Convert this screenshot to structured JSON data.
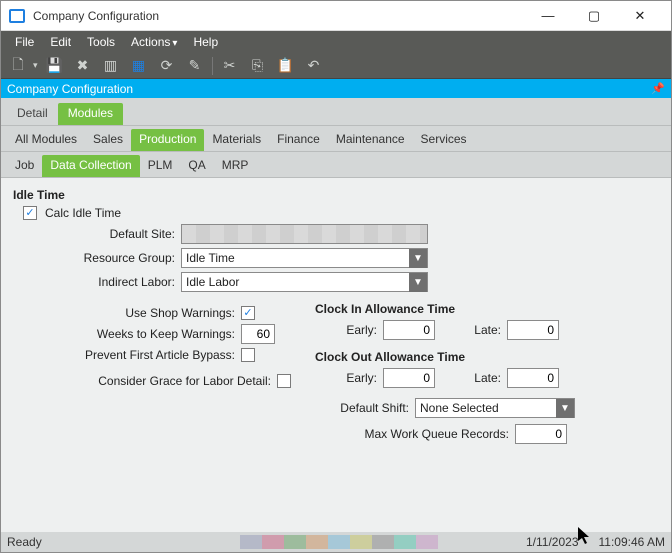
{
  "window": {
    "title": "Company Configuration"
  },
  "menus": {
    "file": "File",
    "edit": "Edit",
    "tools": "Tools",
    "actions": "Actions",
    "help": "Help"
  },
  "bluebar": {
    "label": "Company Configuration"
  },
  "tabs_group1": {
    "detail": "Detail",
    "modules": "Modules"
  },
  "tabs_group2": {
    "all_modules": "All Modules",
    "sales": "Sales",
    "production": "Production",
    "materials": "Materials",
    "finance": "Finance",
    "maintenance": "Maintenance",
    "services": "Services"
  },
  "tabs_group3": {
    "job": "Job",
    "data_collection": "Data Collection",
    "plm": "PLM",
    "qa": "QA",
    "mrp": "MRP"
  },
  "idle": {
    "section": "Idle Time",
    "calc_label": "Calc Idle Time",
    "calc_checked": true,
    "default_site_label": "Default Site:",
    "default_site_value": "",
    "resource_group_label": "Resource Group:",
    "resource_group_value": "Idle Time",
    "indirect_labor_label": "Indirect Labor:",
    "indirect_labor_value": "Idle Labor"
  },
  "options": {
    "use_shop_warnings_label": "Use Shop Warnings:",
    "use_shop_warnings_checked": true,
    "weeks_label": "Weeks to Keep Warnings:",
    "weeks_value": "60",
    "prevent_label": "Prevent First Article Bypass:",
    "prevent_checked": false,
    "grace_label": "Consider Grace for Labor Detail:",
    "grace_checked": false
  },
  "allowance": {
    "clock_in_title": "Clock In Allowance Time",
    "clock_out_title": "Clock Out Allowance Time",
    "early_label": "Early:",
    "late_label": "Late:",
    "in_early": "0",
    "in_late": "0",
    "out_early": "0",
    "out_late": "0",
    "default_shift_label": "Default Shift:",
    "default_shift_value": "None Selected",
    "max_queue_label": "Max Work Queue Records:",
    "max_queue_value": "0"
  },
  "status": {
    "ready": "Ready",
    "date": "1/11/2023",
    "time": "11:09:46 AM"
  },
  "swatch_colors": [
    "#9aa0bb",
    "#cc6b8a",
    "#70a66e",
    "#d09a6d",
    "#7fbbd8",
    "#c7c76d",
    "#8f8f8f",
    "#5fc7b0",
    "#c99ac7"
  ]
}
